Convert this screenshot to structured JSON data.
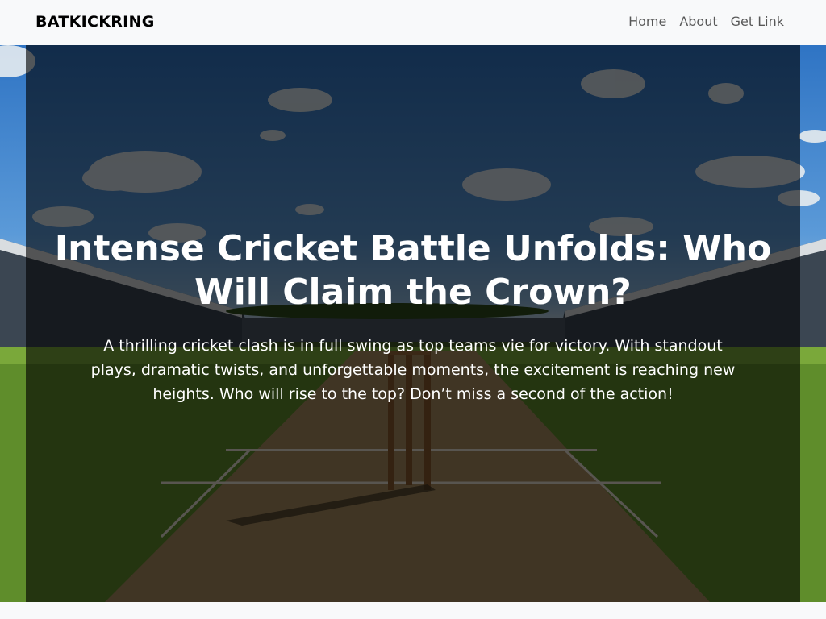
{
  "navbar": {
    "brand": "BATKICKRING",
    "links": [
      {
        "label": "Home"
      },
      {
        "label": "About"
      },
      {
        "label": "Get Link"
      }
    ]
  },
  "hero": {
    "title": "Intense Cricket Battle Unfolds: Who Will Claim the Crown?",
    "lead": "A thrilling cricket clash is in full swing as top teams vie for victory. With standout plays, dramatic twists, and unforgettable moments, the excitement is reaching new heights. Who will rise to the top? Don’t miss a second of the action!",
    "background_image": "cricket-stadium-pitch-with-wicket-stumps"
  }
}
